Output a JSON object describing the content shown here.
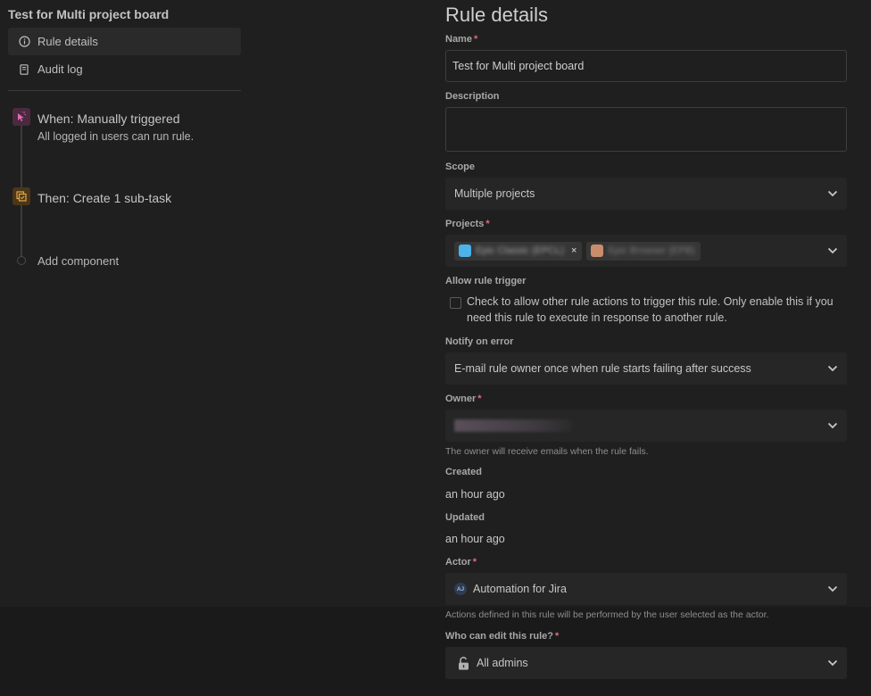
{
  "sidebar": {
    "rule_title": "Test for Multi project board",
    "nav": [
      {
        "label": "Rule details",
        "icon": "info-icon",
        "active": true
      },
      {
        "label": "Audit log",
        "icon": "document-icon",
        "active": false
      }
    ],
    "components": [
      {
        "title": "When: Manually triggered",
        "subtitle": "All logged in users can run rule.",
        "icon": "cursor-click-icon",
        "color": "#e36bb5"
      },
      {
        "title": "Then: Create 1 sub-task",
        "icon": "subtask-icon",
        "color": "#e5a94a"
      }
    ],
    "add_component": "Add component"
  },
  "form": {
    "title": "Rule details",
    "name_label": "Name",
    "name_value": "Test for Multi project board",
    "description_label": "Description",
    "description_value": "",
    "scope_label": "Scope",
    "scope_value": "Multiple projects",
    "projects_label": "Projects",
    "projects": [
      {
        "label": "Epic Classic (EPCL)",
        "avatar_color": "#4bb3e8",
        "removable": true
      },
      {
        "label": "Epic Browser (EPB)",
        "avatar_color": "#c98d6b",
        "removable": false
      }
    ],
    "allow_trigger_label": "Allow rule trigger",
    "allow_trigger_text": "Check to allow other rule actions to trigger this rule. Only enable this if you need this rule to execute in response to another rule.",
    "allow_trigger_checked": false,
    "notify_label": "Notify on error",
    "notify_value": "E-mail rule owner once when rule starts failing after success",
    "owner_label": "Owner",
    "owner_helper": "The owner will receive emails when the rule fails.",
    "created_label": "Created",
    "created_value": "an hour ago",
    "updated_label": "Updated",
    "updated_value": "an hour ago",
    "actor_label": "Actor",
    "actor_value": "Automation for Jira",
    "actor_avatar": "AJ",
    "actor_helper": "Actions defined in this rule will be performed by the user selected as the actor.",
    "edit_label": "Who can edit this rule?",
    "edit_value": "All admins"
  },
  "colors": {
    "background": "#1f1f1f",
    "required_asterisk": "#e5697a",
    "select_background": "#262626"
  }
}
